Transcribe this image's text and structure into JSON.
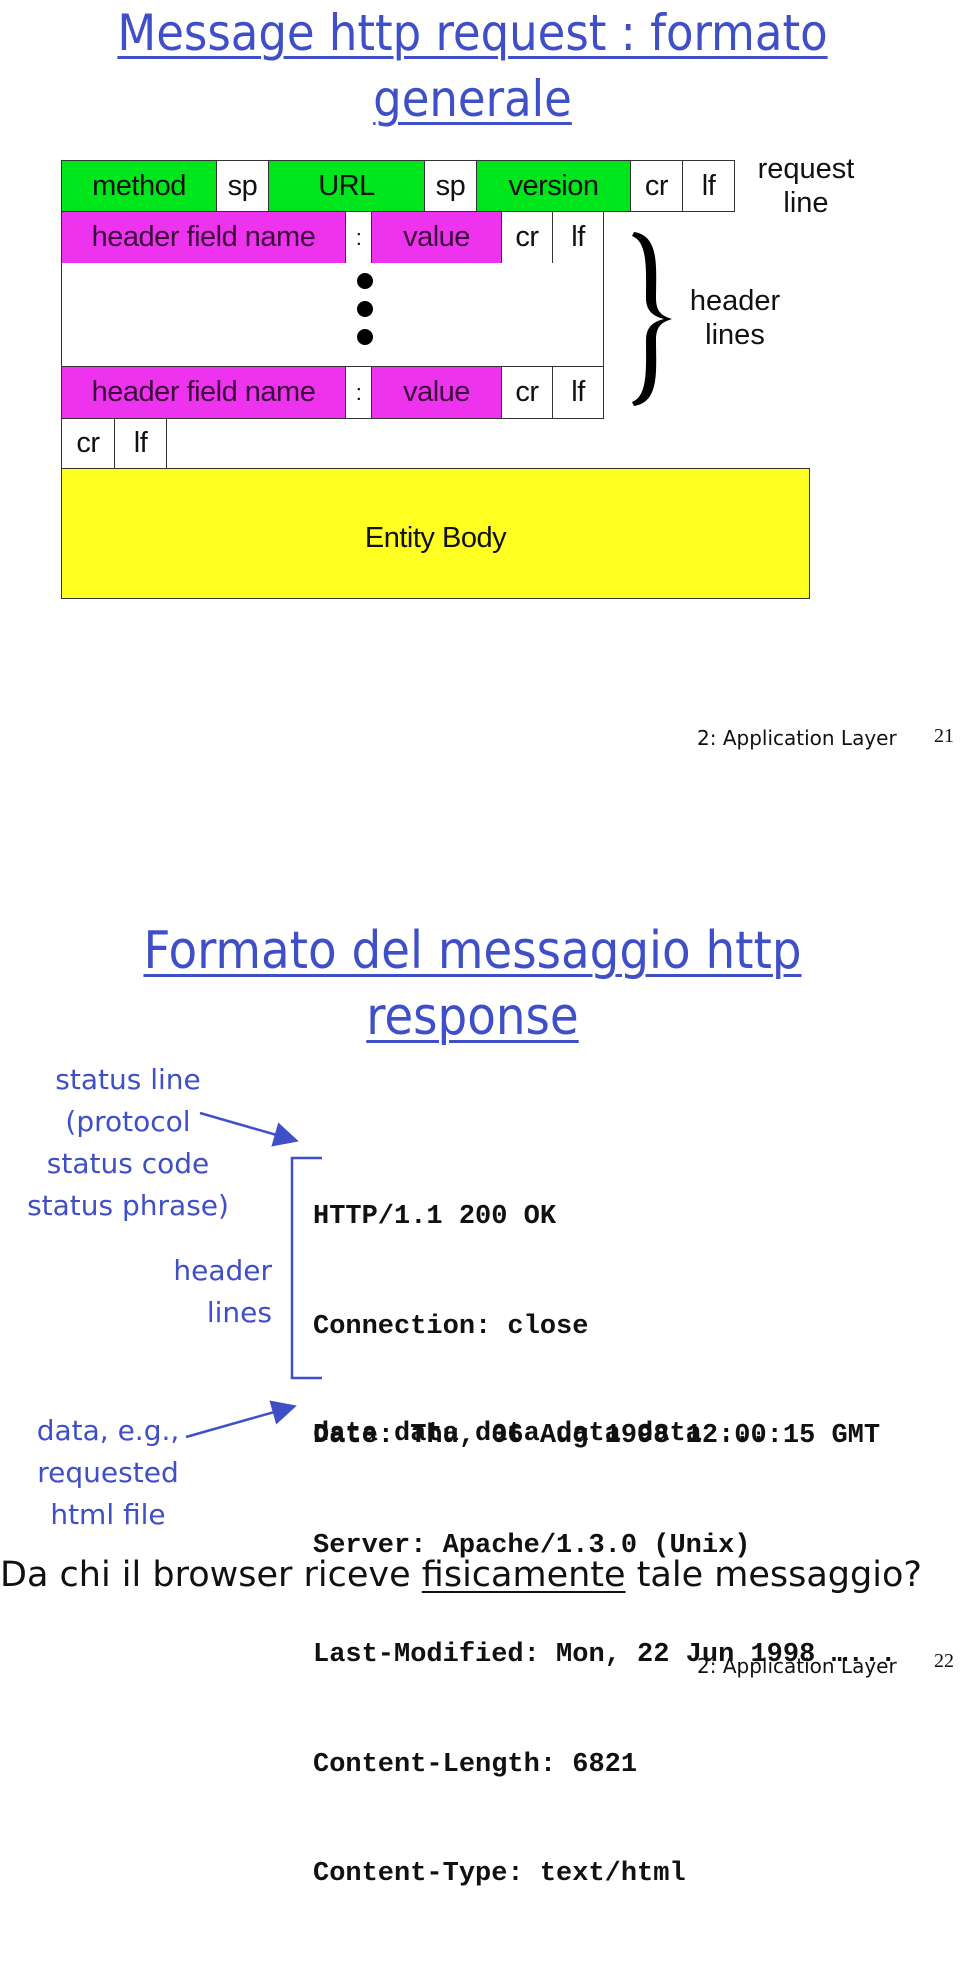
{
  "slide1": {
    "title_line1": "Message http request : formato",
    "title_line2": "generale",
    "request_line": {
      "cells": [
        {
          "label": "method",
          "kind": "field"
        },
        {
          "label": "sp",
          "kind": "separator"
        },
        {
          "label": "URL",
          "kind": "field"
        },
        {
          "label": "sp",
          "kind": "separator"
        },
        {
          "label": "version",
          "kind": "field"
        },
        {
          "label": "cr",
          "kind": "separator"
        },
        {
          "label": "lf",
          "kind": "separator"
        }
      ],
      "annotation_line1": "request",
      "annotation_line2": "line"
    },
    "header_line": {
      "name": "header field name",
      "colon": ":",
      "value": "value",
      "cr": "cr",
      "lf": "lf"
    },
    "header_annotation_line1": "header",
    "header_annotation_line2": "lines",
    "blank_line": {
      "cr": "cr",
      "lf": "lf"
    },
    "entity_body": "Entity Body",
    "colors": {
      "request_line": "#00e61c",
      "header_line": "#ee33ee",
      "entity_body": "#ffff22"
    },
    "footer": {
      "label": "2: Application Layer",
      "page": "21"
    }
  },
  "slide2": {
    "title_line1": "Formato del messaggio http",
    "title_line2": "response",
    "annotations": {
      "status_line": [
        "status line",
        "(protocol",
        "status code",
        "status phrase)"
      ],
      "header_lines": [
        "header",
        "lines"
      ],
      "data": [
        "data, e.g.,",
        "requested",
        "html file"
      ]
    },
    "response_lines": [
      "HTTP/1.1 200 OK",
      "Connection: close",
      "Date: Thu, 06 Aug 1998 12:00:15 GMT",
      "Server: Apache/1.3.0 (Unix)",
      "Last-Modified: Mon, 22 Jun 1998 …...",
      "Content-Length: 6821",
      "Content-Type: text/html"
    ],
    "data_line": "data data data data data ...",
    "question": {
      "before": "Da chi il browser riceve ",
      "emphasis": "fisicamente",
      "after": " tale messaggio?"
    },
    "colors": {
      "title": "#3f4fc8",
      "annotation": "#3f4fc8"
    },
    "footer": {
      "label": "2: Application Layer",
      "page": "22"
    }
  }
}
